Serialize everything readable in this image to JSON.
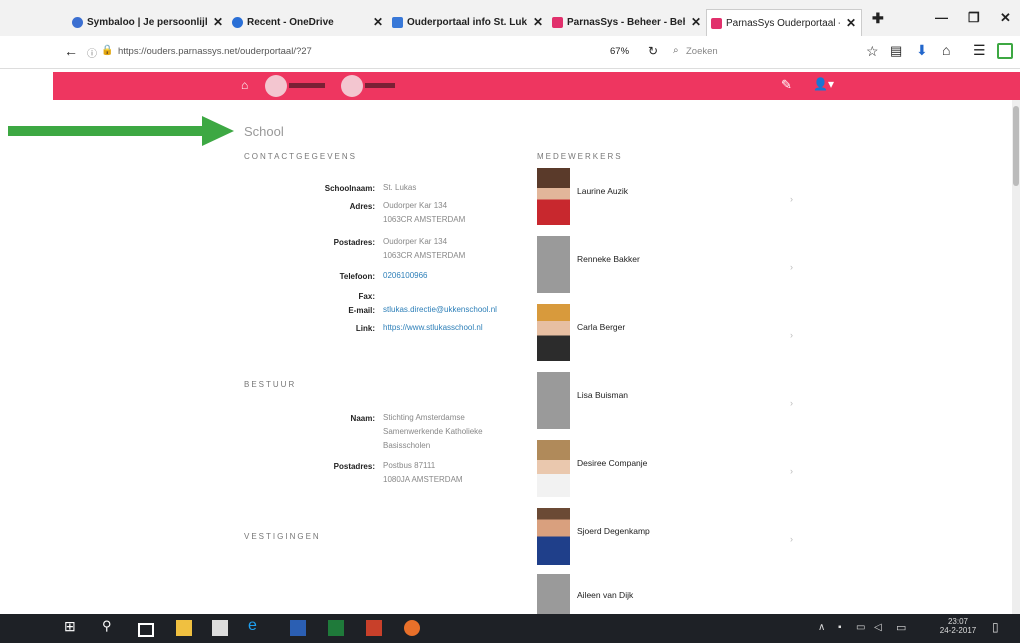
{
  "tabs": [
    {
      "title": "Symbaloo | Je persoonlijk...",
      "color": "#3b6fd1"
    },
    {
      "title": "Recent - OneDrive",
      "color": "#2a6fd6"
    },
    {
      "title": "Ouderportaal info St. Lukas...",
      "color": "#3878d8"
    },
    {
      "title": "ParnasSys - Beheer - Beheer",
      "color": "#e1306c"
    },
    {
      "title": "ParnasSys Ouderportaal - ...",
      "color": "#e1306c"
    }
  ],
  "address": {
    "url": "https://ouders.parnassys.net/ouderportaal/?27",
    "zoom": "67%",
    "search_placeholder": "Zoeken"
  },
  "page": {
    "heading": "School",
    "contact_label": "CONTACTGEGEVENS",
    "contact": [
      {
        "label": "Schoolnaam:",
        "lines": [
          "St. Lukas"
        ]
      },
      {
        "label": "Adres:",
        "lines": [
          "Oudorper Kar 134",
          "1063CR AMSTERDAM"
        ]
      },
      {
        "label": "Postadres:",
        "lines": [
          "Oudorper Kar 134",
          "1063CR AMSTERDAM"
        ]
      },
      {
        "label": "Telefoon:",
        "lines": [
          "0206100966"
        ]
      },
      {
        "label": "Fax:",
        "lines": [
          ""
        ]
      },
      {
        "label": "E-mail:",
        "lines": [
          "stlukas.directie@ukkenschool.nl"
        ]
      },
      {
        "label": "Link:",
        "lines": [
          "https://www.stlukasschool.nl"
        ]
      }
    ],
    "board_label": "BESTUUR",
    "board": [
      {
        "label": "Naam:",
        "lines": [
          "Stichting Amsterdamse",
          "Samenwerkende Katholieke",
          "Basisscholen"
        ]
      },
      {
        "label": "Postadres:",
        "lines": [
          "Postbus 87111",
          "1080JA AMSTERDAM"
        ]
      }
    ],
    "locations_label": "VESTIGINGEN",
    "staff_label": "MEDEWERKERS",
    "staff": [
      {
        "name": "Laurine Auzik",
        "photo": "photo"
      },
      {
        "name": "Renneke Bakker",
        "photo": "placeholder"
      },
      {
        "name": "Carla Berger",
        "photo": "photo"
      },
      {
        "name": "Lisa Buisman",
        "photo": "placeholder"
      },
      {
        "name": "Desiree Companje",
        "photo": "photo"
      },
      {
        "name": "Sjoerd Degenkamp",
        "photo": "photo"
      },
      {
        "name": "Aileen van Dijk",
        "photo": "placeholder"
      }
    ]
  },
  "taskbar": {
    "time": "23:07",
    "date": "24-2-2017"
  },
  "colors": {
    "brand": "#ee3660",
    "arrow": "#3da843",
    "taskbar": "#1e2126"
  }
}
